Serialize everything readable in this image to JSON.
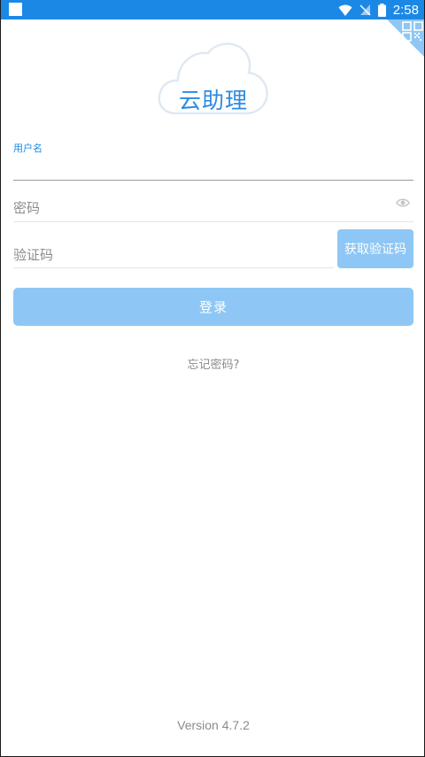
{
  "status_bar": {
    "time": "2:58"
  },
  "logo": {
    "text": "云助理"
  },
  "username": {
    "label": "用户名",
    "value": ""
  },
  "password": {
    "placeholder": "密码"
  },
  "verification": {
    "placeholder": "验证码",
    "get_code_label": "获取验证码"
  },
  "login_button_label": "登录",
  "forgot_password_label": "忘记密码?",
  "version_label": "Version  4.7.2",
  "colors": {
    "status_bar": "#1c88e6",
    "primary_text": "#2c8be0",
    "button_disabled": "#8ec7f5",
    "hint_text": "#8a8a8a"
  }
}
